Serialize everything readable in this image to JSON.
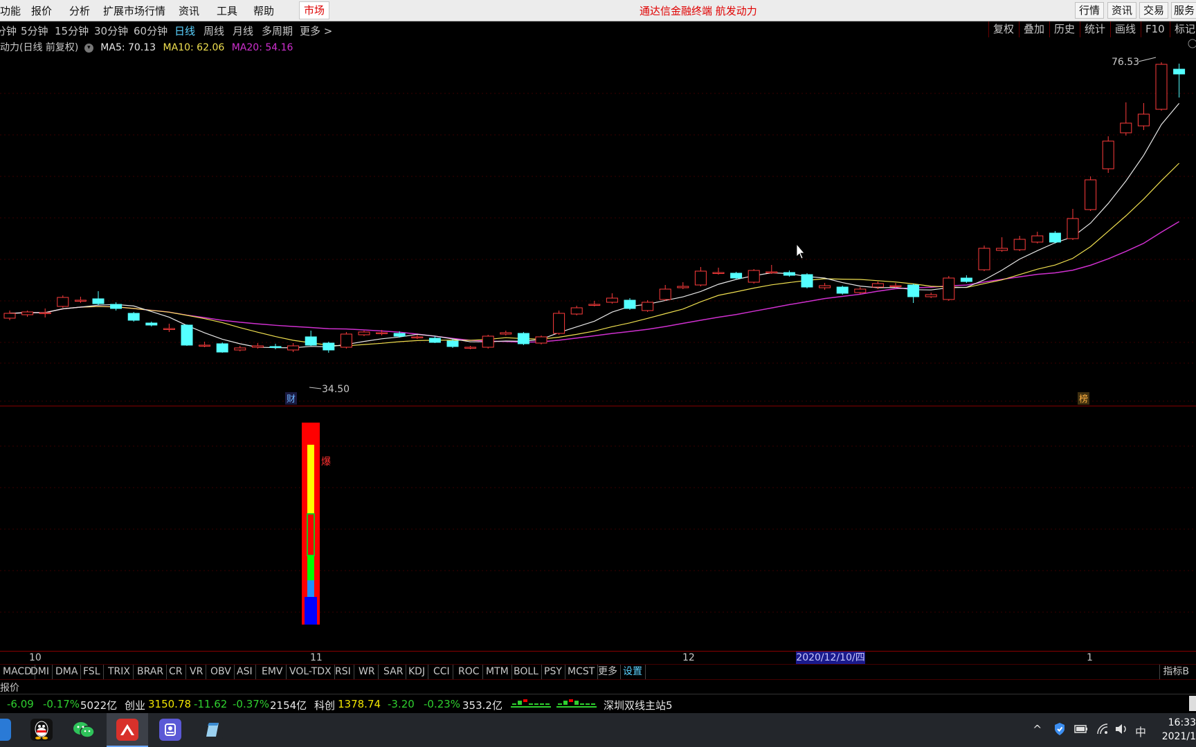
{
  "menu": {
    "items": [
      "功能",
      "报价",
      "分析",
      "扩展市场行情",
      "资讯",
      "工具",
      "帮助"
    ],
    "market_button": "市场",
    "title": "通达信金融终端  航发动力",
    "right_buttons": [
      "行情",
      "资讯",
      "交易",
      "服务"
    ]
  },
  "period_bar": {
    "periods": [
      "分钟",
      "5分钟",
      "15分钟",
      "30分钟",
      "60分钟",
      "日线",
      "周线",
      "月线",
      "多周期",
      "更多 >"
    ],
    "active": "日线",
    "tools": [
      "复权",
      "叠加",
      "历史",
      "统计",
      "画线",
      "F10",
      "标记"
    ]
  },
  "ma_info": {
    "stock_label": "动力(日线 前复权)",
    "ma5": "MA5: 70.13",
    "ma10": "MA10: 62.06",
    "ma20": "MA20: 54.16",
    "colors": {
      "ma5": "#e8e8e8",
      "ma10": "#f0e050",
      "ma20": "#d030d0"
    }
  },
  "annotations": {
    "high_label": "76.53",
    "low_label": "34.50",
    "marker_cai": "财",
    "marker_bang": "榜",
    "burst_label": "爆"
  },
  "xaxis": {
    "labels": [
      "10",
      "11",
      "12",
      "1"
    ],
    "cursor_date": "2020/12/10/四"
  },
  "indicator_tabs": [
    "MACD",
    "DMI",
    "DMA",
    "FSL",
    "TRIX",
    "BRAR",
    "CR",
    "VR",
    "OBV",
    "ASI",
    "EMV",
    "VOL-TDX",
    "RSI",
    "WR",
    "SAR",
    "KDJ",
    "CCI",
    "ROC",
    "MTM",
    "BOLL",
    "PSY",
    "MCST",
    "更多",
    "设置"
  ],
  "indicator_right": "指标B",
  "quote_label": "报价",
  "status": {
    "sh_change": "-6.09",
    "sh_pct": "-0.17%",
    "sh_amount": "5022亿",
    "cy_name": "创业",
    "cy_value": "3150.78",
    "cy_change": "-11.62",
    "cy_pct": "-0.37%",
    "cy_amount": "2154亿",
    "kc_name": "科创",
    "kc_value": "1378.74",
    "kc_change": "-3.20",
    "kc_pct": "-0.23%",
    "kc_amount": "353.2亿",
    "server": "深圳双线主站5"
  },
  "taskbar": {
    "ime": "中",
    "time": "16:33",
    "date": "2021/1"
  },
  "chart_data": {
    "type": "candlestick",
    "ma5": "70.13",
    "ma10": "62.06",
    "ma20": "54.16",
    "candles_note": "daily bars, Sep 2020 - Jan 2021",
    "high": 76.53,
    "low": 34.5,
    "candles": [
      {
        "o": 39.5,
        "c": 40.2,
        "h": 40.6,
        "l": 39.2
      },
      {
        "o": 40.0,
        "c": 40.4,
        "h": 40.6,
        "l": 39.7
      },
      {
        "o": 40.3,
        "c": 40.3,
        "h": 40.9,
        "l": 39.6
      },
      {
        "o": 41.2,
        "c": 42.5,
        "h": 42.8,
        "l": 41.0
      },
      {
        "o": 42.1,
        "c": 42.1,
        "h": 42.6,
        "l": 41.7
      },
      {
        "o": 42.3,
        "c": 41.6,
        "h": 43.4,
        "l": 41.4
      },
      {
        "o": 41.5,
        "c": 40.9,
        "h": 41.8,
        "l": 40.6
      },
      {
        "o": 40.2,
        "c": 39.2,
        "h": 40.4,
        "l": 39.0
      },
      {
        "o": 38.8,
        "c": 38.5,
        "h": 39.0,
        "l": 38.3
      },
      {
        "o": 38.0,
        "c": 38.0,
        "h": 38.7,
        "l": 37.5
      },
      {
        "o": 38.5,
        "c": 35.6,
        "h": 38.6,
        "l": 35.5
      },
      {
        "o": 35.6,
        "c": 35.6,
        "h": 36.1,
        "l": 35.3
      },
      {
        "o": 35.8,
        "c": 34.6,
        "h": 36.0,
        "l": 34.5
      },
      {
        "o": 34.9,
        "c": 35.2,
        "h": 35.5,
        "l": 34.7
      },
      {
        "o": 35.3,
        "c": 35.5,
        "h": 35.9,
        "l": 35.1
      },
      {
        "o": 35.4,
        "c": 35.3,
        "h": 35.8,
        "l": 35.0
      },
      {
        "o": 34.9,
        "c": 35.5,
        "h": 35.9,
        "l": 34.6
      },
      {
        "o": 36.8,
        "c": 35.6,
        "h": 37.7,
        "l": 35.5
      },
      {
        "o": 35.9,
        "c": 34.9,
        "h": 36.1,
        "l": 34.5
      },
      {
        "o": 35.3,
        "c": 37.2,
        "h": 37.5,
        "l": 35.1
      },
      {
        "o": 37.1,
        "c": 37.5,
        "h": 37.7,
        "l": 36.9
      },
      {
        "o": 37.4,
        "c": 37.4,
        "h": 37.8,
        "l": 37.0
      },
      {
        "o": 37.3,
        "c": 36.9,
        "h": 37.6,
        "l": 36.7
      },
      {
        "o": 36.8,
        "c": 36.8,
        "h": 37.1,
        "l": 36.5
      },
      {
        "o": 36.6,
        "c": 36.0,
        "h": 36.9,
        "l": 35.9
      },
      {
        "o": 36.2,
        "c": 35.4,
        "h": 36.5,
        "l": 35.2
      },
      {
        "o": 35.3,
        "c": 35.3,
        "h": 35.5,
        "l": 35.0
      },
      {
        "o": 35.3,
        "c": 36.9,
        "h": 37.1,
        "l": 35.1
      },
      {
        "o": 37.2,
        "c": 37.4,
        "h": 37.7,
        "l": 37.0
      },
      {
        "o": 37.3,
        "c": 35.8,
        "h": 37.5,
        "l": 35.6
      },
      {
        "o": 35.9,
        "c": 36.8,
        "h": 37.0,
        "l": 35.7
      },
      {
        "o": 37.3,
        "c": 40.2,
        "h": 40.6,
        "l": 37.1
      },
      {
        "o": 40.1,
        "c": 41.0,
        "h": 41.3,
        "l": 39.9
      },
      {
        "o": 41.5,
        "c": 41.5,
        "h": 42.0,
        "l": 41.2
      },
      {
        "o": 41.8,
        "c": 42.4,
        "h": 43.1,
        "l": 41.6
      },
      {
        "o": 42.1,
        "c": 40.9,
        "h": 42.4,
        "l": 40.7
      },
      {
        "o": 40.6,
        "c": 41.8,
        "h": 42.1,
        "l": 40.4
      },
      {
        "o": 42.2,
        "c": 43.7,
        "h": 44.3,
        "l": 42.0
      },
      {
        "o": 43.9,
        "c": 44.1,
        "h": 44.7,
        "l": 43.7
      },
      {
        "o": 44.3,
        "c": 46.3,
        "h": 46.9,
        "l": 44.1
      },
      {
        "o": 46.1,
        "c": 46.1,
        "h": 46.8,
        "l": 45.8
      },
      {
        "o": 46.0,
        "c": 45.3,
        "h": 46.2,
        "l": 45.1
      },
      {
        "o": 44.7,
        "c": 46.4,
        "h": 46.6,
        "l": 44.5
      },
      {
        "o": 46.2,
        "c": 46.2,
        "h": 47.2,
        "l": 45.9
      },
      {
        "o": 46.1,
        "c": 45.7,
        "h": 46.4,
        "l": 45.5
      },
      {
        "o": 45.8,
        "c": 44.0,
        "h": 46.0,
        "l": 43.8
      },
      {
        "o": 43.9,
        "c": 44.2,
        "h": 44.6,
        "l": 43.6
      },
      {
        "o": 44.0,
        "c": 43.1,
        "h": 44.2,
        "l": 42.9
      },
      {
        "o": 43.2,
        "c": 43.7,
        "h": 44.0,
        "l": 43.0
      },
      {
        "o": 44.0,
        "c": 44.5,
        "h": 44.8,
        "l": 43.7
      },
      {
        "o": 44.2,
        "c": 44.2,
        "h": 44.6,
        "l": 43.9
      },
      {
        "o": 44.3,
        "c": 42.6,
        "h": 44.5,
        "l": 41.7
      },
      {
        "o": 42.6,
        "c": 42.9,
        "h": 43.2,
        "l": 42.4
      },
      {
        "o": 42.2,
        "c": 45.3,
        "h": 45.6,
        "l": 42.0
      },
      {
        "o": 45.3,
        "c": 44.8,
        "h": 45.7,
        "l": 44.6
      },
      {
        "o": 46.5,
        "c": 49.6,
        "h": 50.0,
        "l": 46.3
      },
      {
        "o": 49.3,
        "c": 49.6,
        "h": 51.2,
        "l": 49.1
      },
      {
        "o": 49.4,
        "c": 50.9,
        "h": 51.4,
        "l": 49.2
      },
      {
        "o": 50.5,
        "c": 51.4,
        "h": 52.0,
        "l": 50.3
      },
      {
        "o": 51.8,
        "c": 50.5,
        "h": 52.1,
        "l": 50.3
      },
      {
        "o": 51.0,
        "c": 53.9,
        "h": 55.3,
        "l": 50.8
      },
      {
        "o": 55.2,
        "c": 59.5,
        "h": 60.0,
        "l": 55.0
      },
      {
        "o": 61.1,
        "c": 65.1,
        "h": 65.8,
        "l": 60.5
      },
      {
        "o": 66.3,
        "c": 67.7,
        "h": 70.7,
        "l": 65.9
      },
      {
        "o": 67.3,
        "c": 69.0,
        "h": 70.6,
        "l": 66.7
      },
      {
        "o": 69.7,
        "c": 76.2,
        "h": 76.5,
        "l": 69.5
      },
      {
        "o": 75.5,
        "c": 74.8,
        "h": 76.3,
        "l": 71.4
      }
    ]
  }
}
